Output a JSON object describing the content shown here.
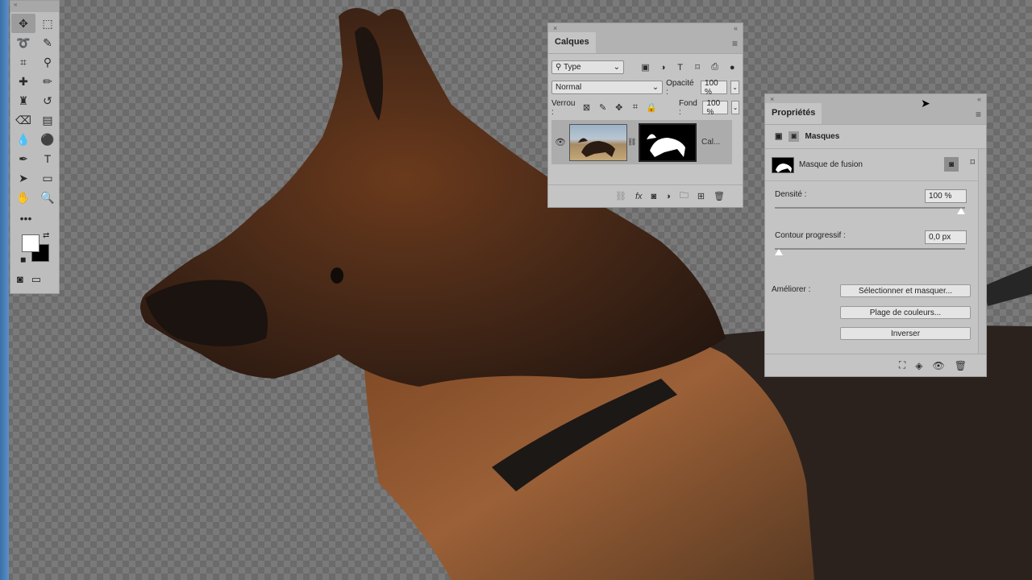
{
  "tools": {
    "items": [
      {
        "name": "move-tool",
        "glyph": "✥"
      },
      {
        "name": "marquee-tool",
        "glyph": "⬚"
      },
      {
        "name": "lasso-tool",
        "glyph": "➰"
      },
      {
        "name": "quick-select-tool",
        "glyph": "✎"
      },
      {
        "name": "crop-tool",
        "glyph": "⌗"
      },
      {
        "name": "eyedropper-tool",
        "glyph": "⚲"
      },
      {
        "name": "healing-tool",
        "glyph": "✚"
      },
      {
        "name": "brush-tool",
        "glyph": "✏"
      },
      {
        "name": "stamp-tool",
        "glyph": "♜"
      },
      {
        "name": "history-brush-tool",
        "glyph": "↺"
      },
      {
        "name": "eraser-tool",
        "glyph": "⌫"
      },
      {
        "name": "gradient-tool",
        "glyph": "▤"
      },
      {
        "name": "blur-tool",
        "glyph": "💧"
      },
      {
        "name": "dodge-tool",
        "glyph": "⚫"
      },
      {
        "name": "pen-tool",
        "glyph": "✒"
      },
      {
        "name": "type-tool",
        "glyph": "T"
      },
      {
        "name": "path-select-tool",
        "glyph": "➤"
      },
      {
        "name": "rectangle-tool",
        "glyph": "▭"
      },
      {
        "name": "hand-tool",
        "glyph": "✋"
      },
      {
        "name": "zoom-tool",
        "glyph": "🔍"
      }
    ],
    "more": "•••"
  },
  "layers": {
    "tab": "Calques",
    "filter": "Type",
    "blend_mode": "Normal",
    "opacity_label": "Opacité :",
    "opacity_value": "100 %",
    "lock_label": "Verrou :",
    "fill_label": "Fond :",
    "fill_value": "100 %",
    "layer_name": "Cal..."
  },
  "properties": {
    "tab": "Propriétés",
    "section": "Masques",
    "mask_type": "Masque de fusion",
    "density_label": "Densité :",
    "density_value": "100 %",
    "density": 1.0,
    "feather_label": "Contour progressif :",
    "feather_value": "0,0 px",
    "feather": 0.0,
    "refine_label": "Améliorer :",
    "btn_select_mask": "Sélectionner et masquer...",
    "btn_color_range": "Plage de couleurs...",
    "btn_invert": "Inverser"
  }
}
